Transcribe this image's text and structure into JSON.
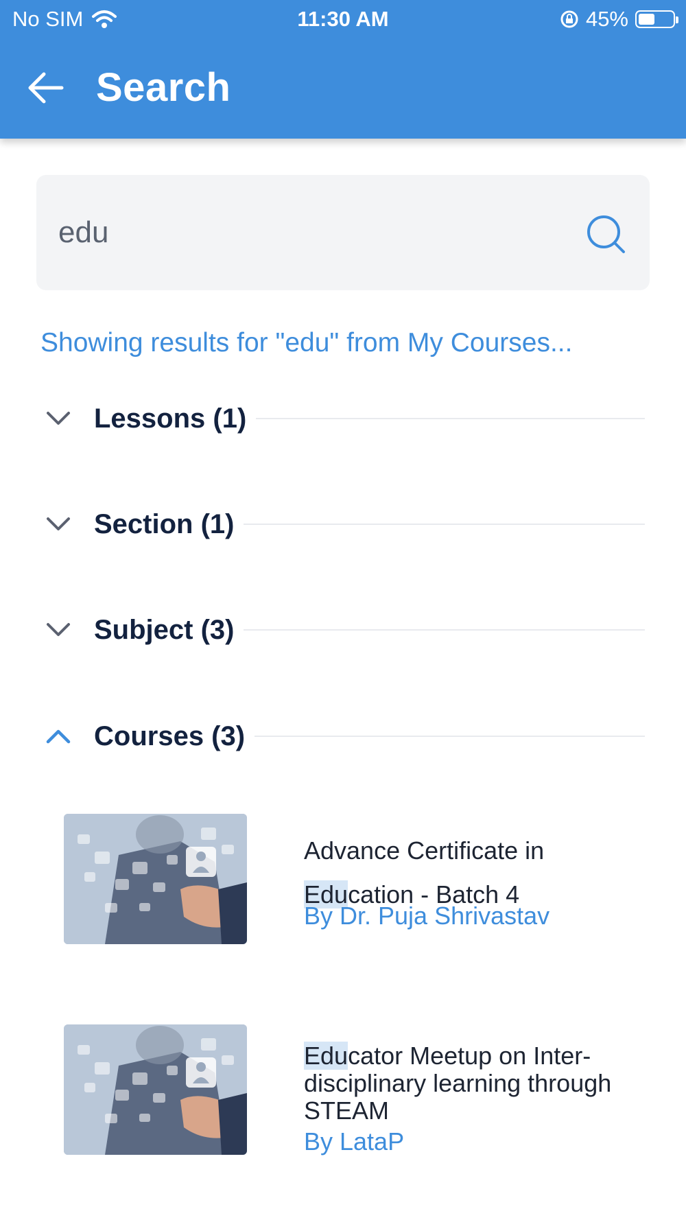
{
  "status_bar": {
    "carrier": "No SIM",
    "time": "11:30 AM",
    "battery_percent": "45%",
    "battery_level": 0.45
  },
  "header": {
    "title": "Search"
  },
  "search": {
    "value": "edu",
    "placeholder": ""
  },
  "results_line": "Showing results for \"edu\" from My Courses...",
  "sections": [
    {
      "label": "Lessons (1)",
      "expanded": false
    },
    {
      "label": "Section (1)",
      "expanded": false
    },
    {
      "label": "Subject (3)",
      "expanded": false
    },
    {
      "label": "Courses (3)",
      "expanded": true
    }
  ],
  "courses": [
    {
      "title_pre": "Advance Certificate in ",
      "title_match": "Edu",
      "title_post": "cation - Batch 4",
      "author": "By Dr. Puja Shrivastav"
    },
    {
      "title_pre": "",
      "title_match": "Edu",
      "title_post": "cator Meetup on Inter-disciplinary learning through STEAM",
      "author": "By LataP"
    }
  ],
  "colors": {
    "primary": "#3e8ddc",
    "heading": "#13223f",
    "highlight": "#d6e6f6",
    "search_bg": "#f3f4f6"
  },
  "icons": {
    "back": "arrow-left-icon",
    "search": "search-icon",
    "collapsed": "chevron-down-icon",
    "expanded": "chevron-up-icon",
    "wifi": "wifi-icon",
    "rotation_lock": "rotation-lock-icon",
    "battery": "battery-icon"
  }
}
